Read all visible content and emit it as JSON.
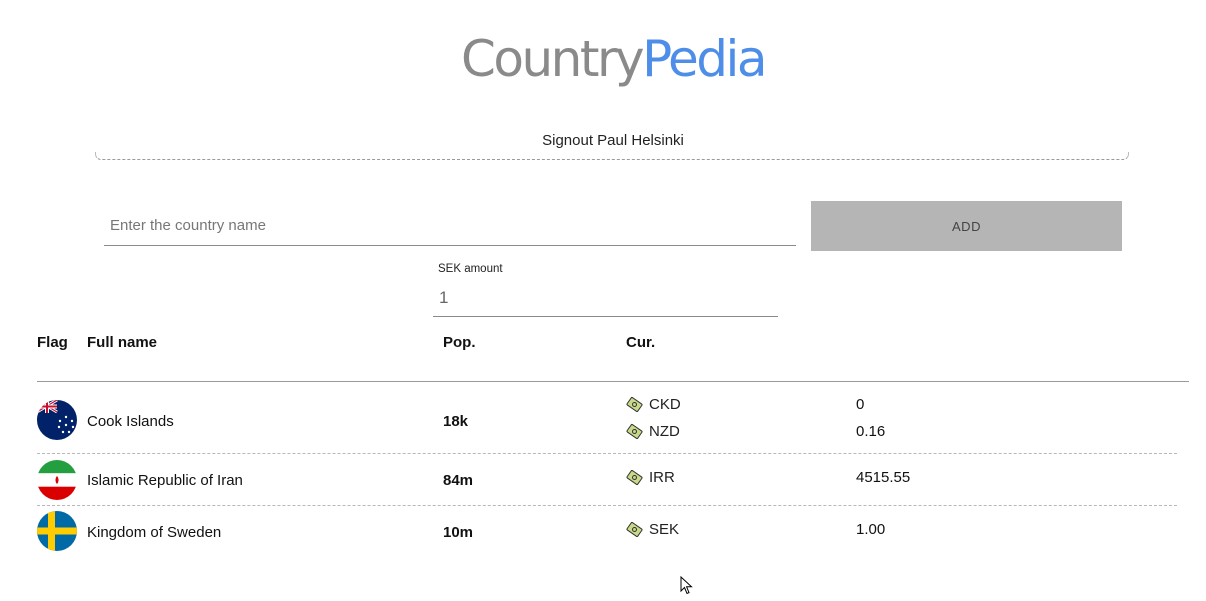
{
  "logo": {
    "part1": "Country",
    "part2": "Pedia"
  },
  "header": {
    "signout": "Signout Paul Helsinki"
  },
  "search": {
    "placeholder": "Enter the country name",
    "add_label": "ADD"
  },
  "sek": {
    "label": "SEK amount",
    "value": "1"
  },
  "table": {
    "headers": {
      "flag": "Flag",
      "name": "Full name",
      "pop": "Pop.",
      "cur": "Cur."
    },
    "rows": [
      {
        "name": "Cook Islands",
        "pop": "18k",
        "flag": "flag-cook-islands",
        "currencies": [
          {
            "code": "CKD",
            "rate": "0"
          },
          {
            "code": "NZD",
            "rate": "0.16"
          }
        ]
      },
      {
        "name": "Islamic Republic of Iran",
        "pop": "84m",
        "flag": "flag-iran",
        "currencies": [
          {
            "code": "IRR",
            "rate": "4515.55"
          }
        ]
      },
      {
        "name": "Kingdom of Sweden",
        "pop": "10m",
        "flag": "flag-sweden",
        "currencies": [
          {
            "code": "SEK",
            "rate": "1.00"
          }
        ]
      }
    ]
  },
  "colors": {
    "accent": "#4f8ee8",
    "logo_gray": "#8a8a8a",
    "button_bg": "#b5b5b5"
  }
}
